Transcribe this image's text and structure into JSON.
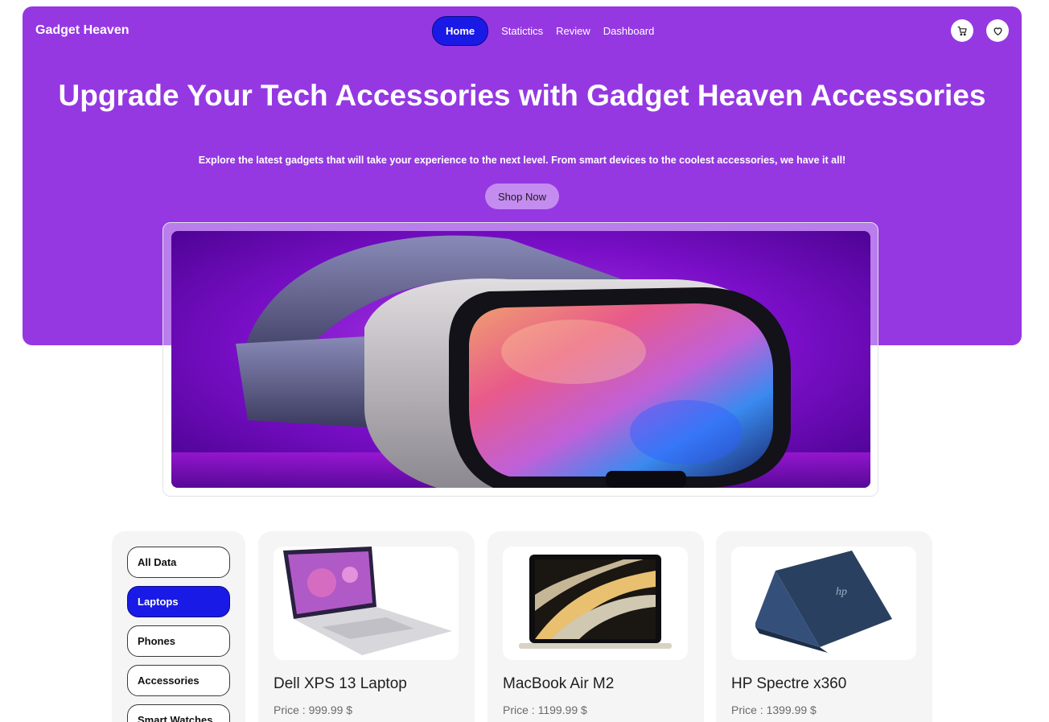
{
  "brand": "Gadget Heaven",
  "nav": {
    "home": "Home",
    "statistics": "Statictics",
    "review": "Review",
    "dashboard": "Dashboard"
  },
  "icons": {
    "cart": "cart-icon",
    "wishlist": "heart-icon"
  },
  "hero": {
    "headline": "Upgrade Your Tech Accessories with Gadget Heaven Accessories",
    "subtext": "Explore the latest gadgets that will take your experience to the next level. From smart devices to the coolest accessories, we have it all!",
    "cta": "Shop Now",
    "image": "vr-headset-image"
  },
  "categories": [
    {
      "label": "All Data",
      "active": false
    },
    {
      "label": "Laptops",
      "active": true
    },
    {
      "label": "Phones",
      "active": false
    },
    {
      "label": "Accessories",
      "active": false
    },
    {
      "label": "Smart Watches",
      "active": false
    }
  ],
  "products": [
    {
      "title": "Dell XPS 13 Laptop",
      "price": "Price : 999.99 $"
    },
    {
      "title": "MacBook Air M2",
      "price": "Price : 1199.99 $"
    },
    {
      "title": "HP Spectre x360",
      "price": "Price : 1399.99 $"
    }
  ],
  "colors": {
    "brand_purple": "#9538E2",
    "active_blue": "#1a1ae6",
    "shop_button": "#c58cf0"
  }
}
